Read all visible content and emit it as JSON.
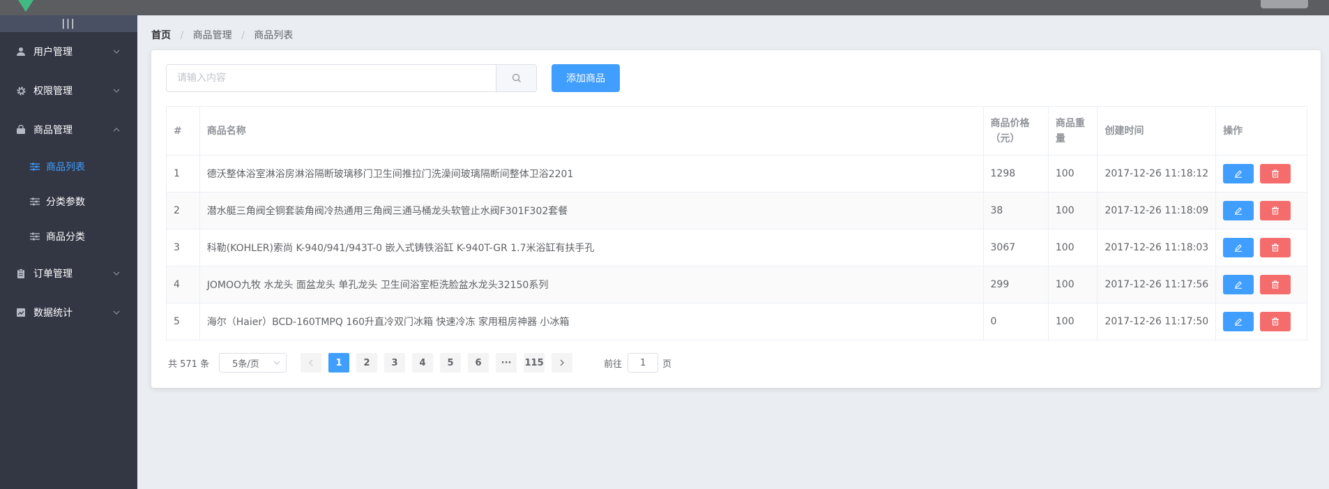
{
  "header": {
    "logout": ""
  },
  "sidebar": {
    "toggle": "|||",
    "menus": [
      {
        "label": "用户管理",
        "icon": "user-icon"
      },
      {
        "label": "权限管理",
        "icon": "gear-icon"
      },
      {
        "label": "商品管理",
        "icon": "shopping-bag-icon",
        "expanded": true,
        "children": [
          {
            "label": "商品列表",
            "active": true
          },
          {
            "label": "分类参数"
          },
          {
            "label": "商品分类"
          }
        ]
      },
      {
        "label": "订单管理",
        "icon": "clipboard-icon"
      },
      {
        "label": "数据统计",
        "icon": "chart-icon"
      }
    ],
    "accent": "#409eff"
  },
  "breadcrumb": [
    "首页",
    "商品管理",
    "商品列表"
  ],
  "toolbar": {
    "search_placeholder": "请输入内容",
    "search_value": "",
    "add_label": "添加商品"
  },
  "table": {
    "headers": {
      "index": "#",
      "name": "商品名称",
      "price": "商品价格（元）",
      "weight": "商品重量",
      "created": "创建时间",
      "ops": "操作"
    },
    "rows": [
      {
        "index": "1",
        "name": "德沃整体浴室淋浴房淋浴隔断玻璃移门卫生间推拉门洗澡间玻璃隔断间整体卫浴2201",
        "price": "1298",
        "weight": "100",
        "created": "2017-12-26 11:18:12"
      },
      {
        "index": "2",
        "name": "潜水艇三角阀全铜套装角阀冷热通用三角阀三通马桶龙头软管止水阀F301F302套餐",
        "price": "38",
        "weight": "100",
        "created": "2017-12-26 11:18:09"
      },
      {
        "index": "3",
        "name": "科勒(KOHLER)索尚 K-940/941/943T-0 嵌入式铸铁浴缸 K-940T-GR 1.7米浴缸有扶手孔",
        "price": "3067",
        "weight": "100",
        "created": "2017-12-26 11:18:03"
      },
      {
        "index": "4",
        "name": "JOMOO九牧 水龙头 面盆龙头 单孔龙头 卫生间浴室柜洗脸盆水龙头32150系列",
        "price": "299",
        "weight": "100",
        "created": "2017-12-26 11:17:56"
      },
      {
        "index": "5",
        "name": "海尔（Haier）BCD-160TMPQ 160升直冷双门冰箱 快速冷冻 家用租房神器 小冰箱",
        "price": "0",
        "weight": "100",
        "created": "2017-12-26 11:17:50"
      }
    ],
    "edit_color": "#409eff",
    "delete_color": "#f56c6c"
  },
  "pagination": {
    "total": "共 571 条",
    "page_size": "5条/页",
    "pages": [
      "1",
      "2",
      "3",
      "4",
      "5",
      "6",
      "···",
      "115"
    ],
    "current": "1",
    "goto_label": "前往",
    "goto_value": "1",
    "goto_suffix": "页"
  }
}
